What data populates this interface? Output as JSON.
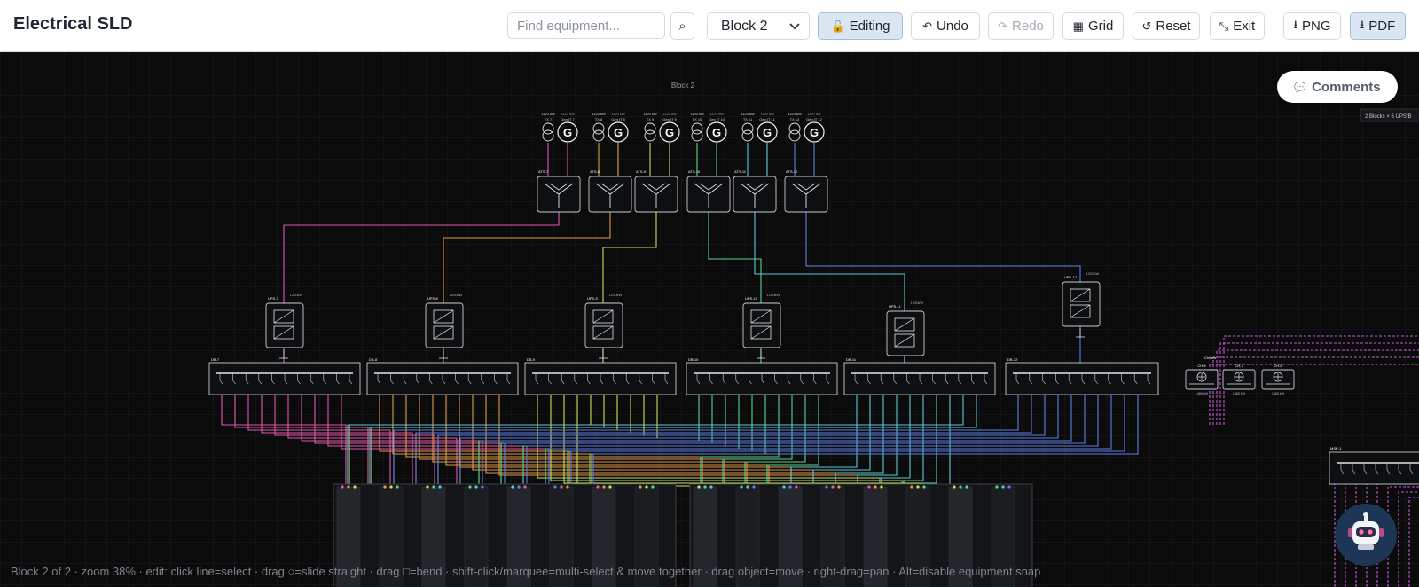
{
  "app": {
    "title": "Electrical SLD"
  },
  "toolbar": {
    "search_placeholder": "Find equipment...",
    "search_icon": "⌕",
    "block_select": "Block 2",
    "editing_label": "Editing",
    "editing_icon": "🔓",
    "undo_label": "Undo",
    "redo_label": "Redo",
    "grid_label": "Grid",
    "reset_label": "Reset",
    "exit_label": "Exit",
    "png_label": "PNG",
    "pdf_label": "PDF",
    "icons": {
      "undo": "↶",
      "redo": "↷",
      "grid": "▦",
      "reset": "↺",
      "exit": "⤡",
      "download": "⭳"
    }
  },
  "canvas": {
    "block_title": "Block 2",
    "side_note": "2 Blocks × 6 UPS/B",
    "generator_symbol": "G",
    "tx_rating": "1120 kW",
    "gen_rating": "1120 kW",
    "gens": [
      {
        "tx": "TX 7",
        "gen": "Gen IT 7"
      },
      {
        "tx": "TX 8",
        "gen": "Gen IT 8"
      },
      {
        "tx": "TX 9",
        "gen": "Gen IT 9"
      },
      {
        "tx": "TX 10",
        "gen": "Gen IT 10"
      },
      {
        "tx": "TX 11",
        "gen": "Gen IT 11"
      },
      {
        "tx": "TX 12",
        "gen": "Gen IT 12"
      }
    ],
    "ats": [
      "ATS-7",
      "ATS-8",
      "ATS-9",
      "ATS-10",
      "ATS-11",
      "ATS-12"
    ],
    "ups": [
      "UPS-7",
      "UPS-8",
      "UPS-9",
      "UPS-10",
      "UPS-11",
      "UPS-12"
    ],
    "ups_rating": "1200kW",
    "db": [
      "DB-7",
      "DB-8",
      "DB-9",
      "DB-10",
      "DB-11",
      "DB-12"
    ],
    "chiller_title": "Chillers",
    "chillers": [
      "CH-6",
      "CH-7",
      "CH-8"
    ],
    "chiller_rating": "1485 kW",
    "mdp_label": "MSP-1",
    "colors": {
      "background": "#0b0b0c",
      "feeds": [
        "#e05aa8",
        "#e09a4a",
        "#c8e25a",
        "#58d68d",
        "#5fc8d8",
        "#5b7fe6"
      ],
      "mech": "#c25ad6"
    }
  },
  "comments": {
    "label": "Comments",
    "icon": "💬"
  },
  "assistant": {
    "icon": "robot-icon"
  },
  "status": {
    "text": "Block 2 of 2 · zoom 38% · edit: click line=select · drag ○=slide straight · drag □=bend · shift-click/marquee=multi-select & move together · drag object=move · right-drag=pan · Alt=disable equipment snap"
  }
}
